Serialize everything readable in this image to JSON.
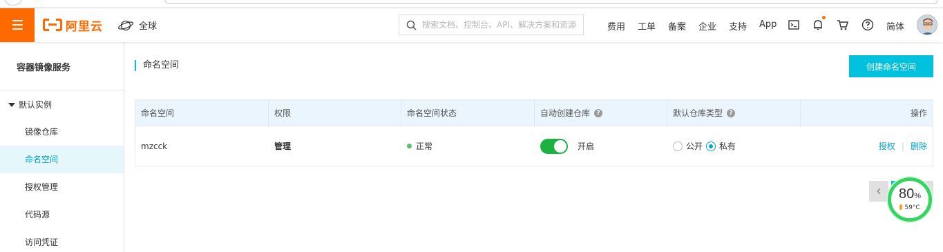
{
  "header": {
    "logo_text": "阿里云",
    "region": "全球",
    "search_placeholder": "搜索文档、控制台、API、解决方案和资源",
    "nav": [
      "费用",
      "工单",
      "备案",
      "企业",
      "支持",
      "App"
    ],
    "language": "简体"
  },
  "sidebar": {
    "title": "容器镜像服务",
    "group": "默认实例",
    "items": [
      {
        "label": "镜像仓库",
        "active": false
      },
      {
        "label": "命名空间",
        "active": true
      },
      {
        "label": "授权管理",
        "active": false
      },
      {
        "label": "代码源",
        "active": false
      },
      {
        "label": "访问凭证",
        "active": false
      }
    ]
  },
  "main": {
    "title": "命名空间",
    "create_button": "创建命名空间",
    "table": {
      "columns": [
        "命名空间",
        "权限",
        "命名空间状态",
        "自动创建仓库",
        "默认仓库类型",
        "操作"
      ],
      "rows": [
        {
          "namespace": "mzcck",
          "permission": "管理",
          "status": "正常",
          "auto_create": "开启",
          "repo_type_public": "公开",
          "repo_type_private": "私有",
          "repo_type_selected": "私有",
          "action_authorize": "授权",
          "action_delete": "删除"
        }
      ]
    }
  },
  "widget": {
    "percent": "80",
    "percent_unit": "%",
    "temperature": "59°C"
  },
  "colors": {
    "brand": "#ff6a00",
    "accent": "#00c1de",
    "link": "#00a2ca",
    "toggle_on": "#1bb23f",
    "status_ok": "#5bbf6c"
  }
}
